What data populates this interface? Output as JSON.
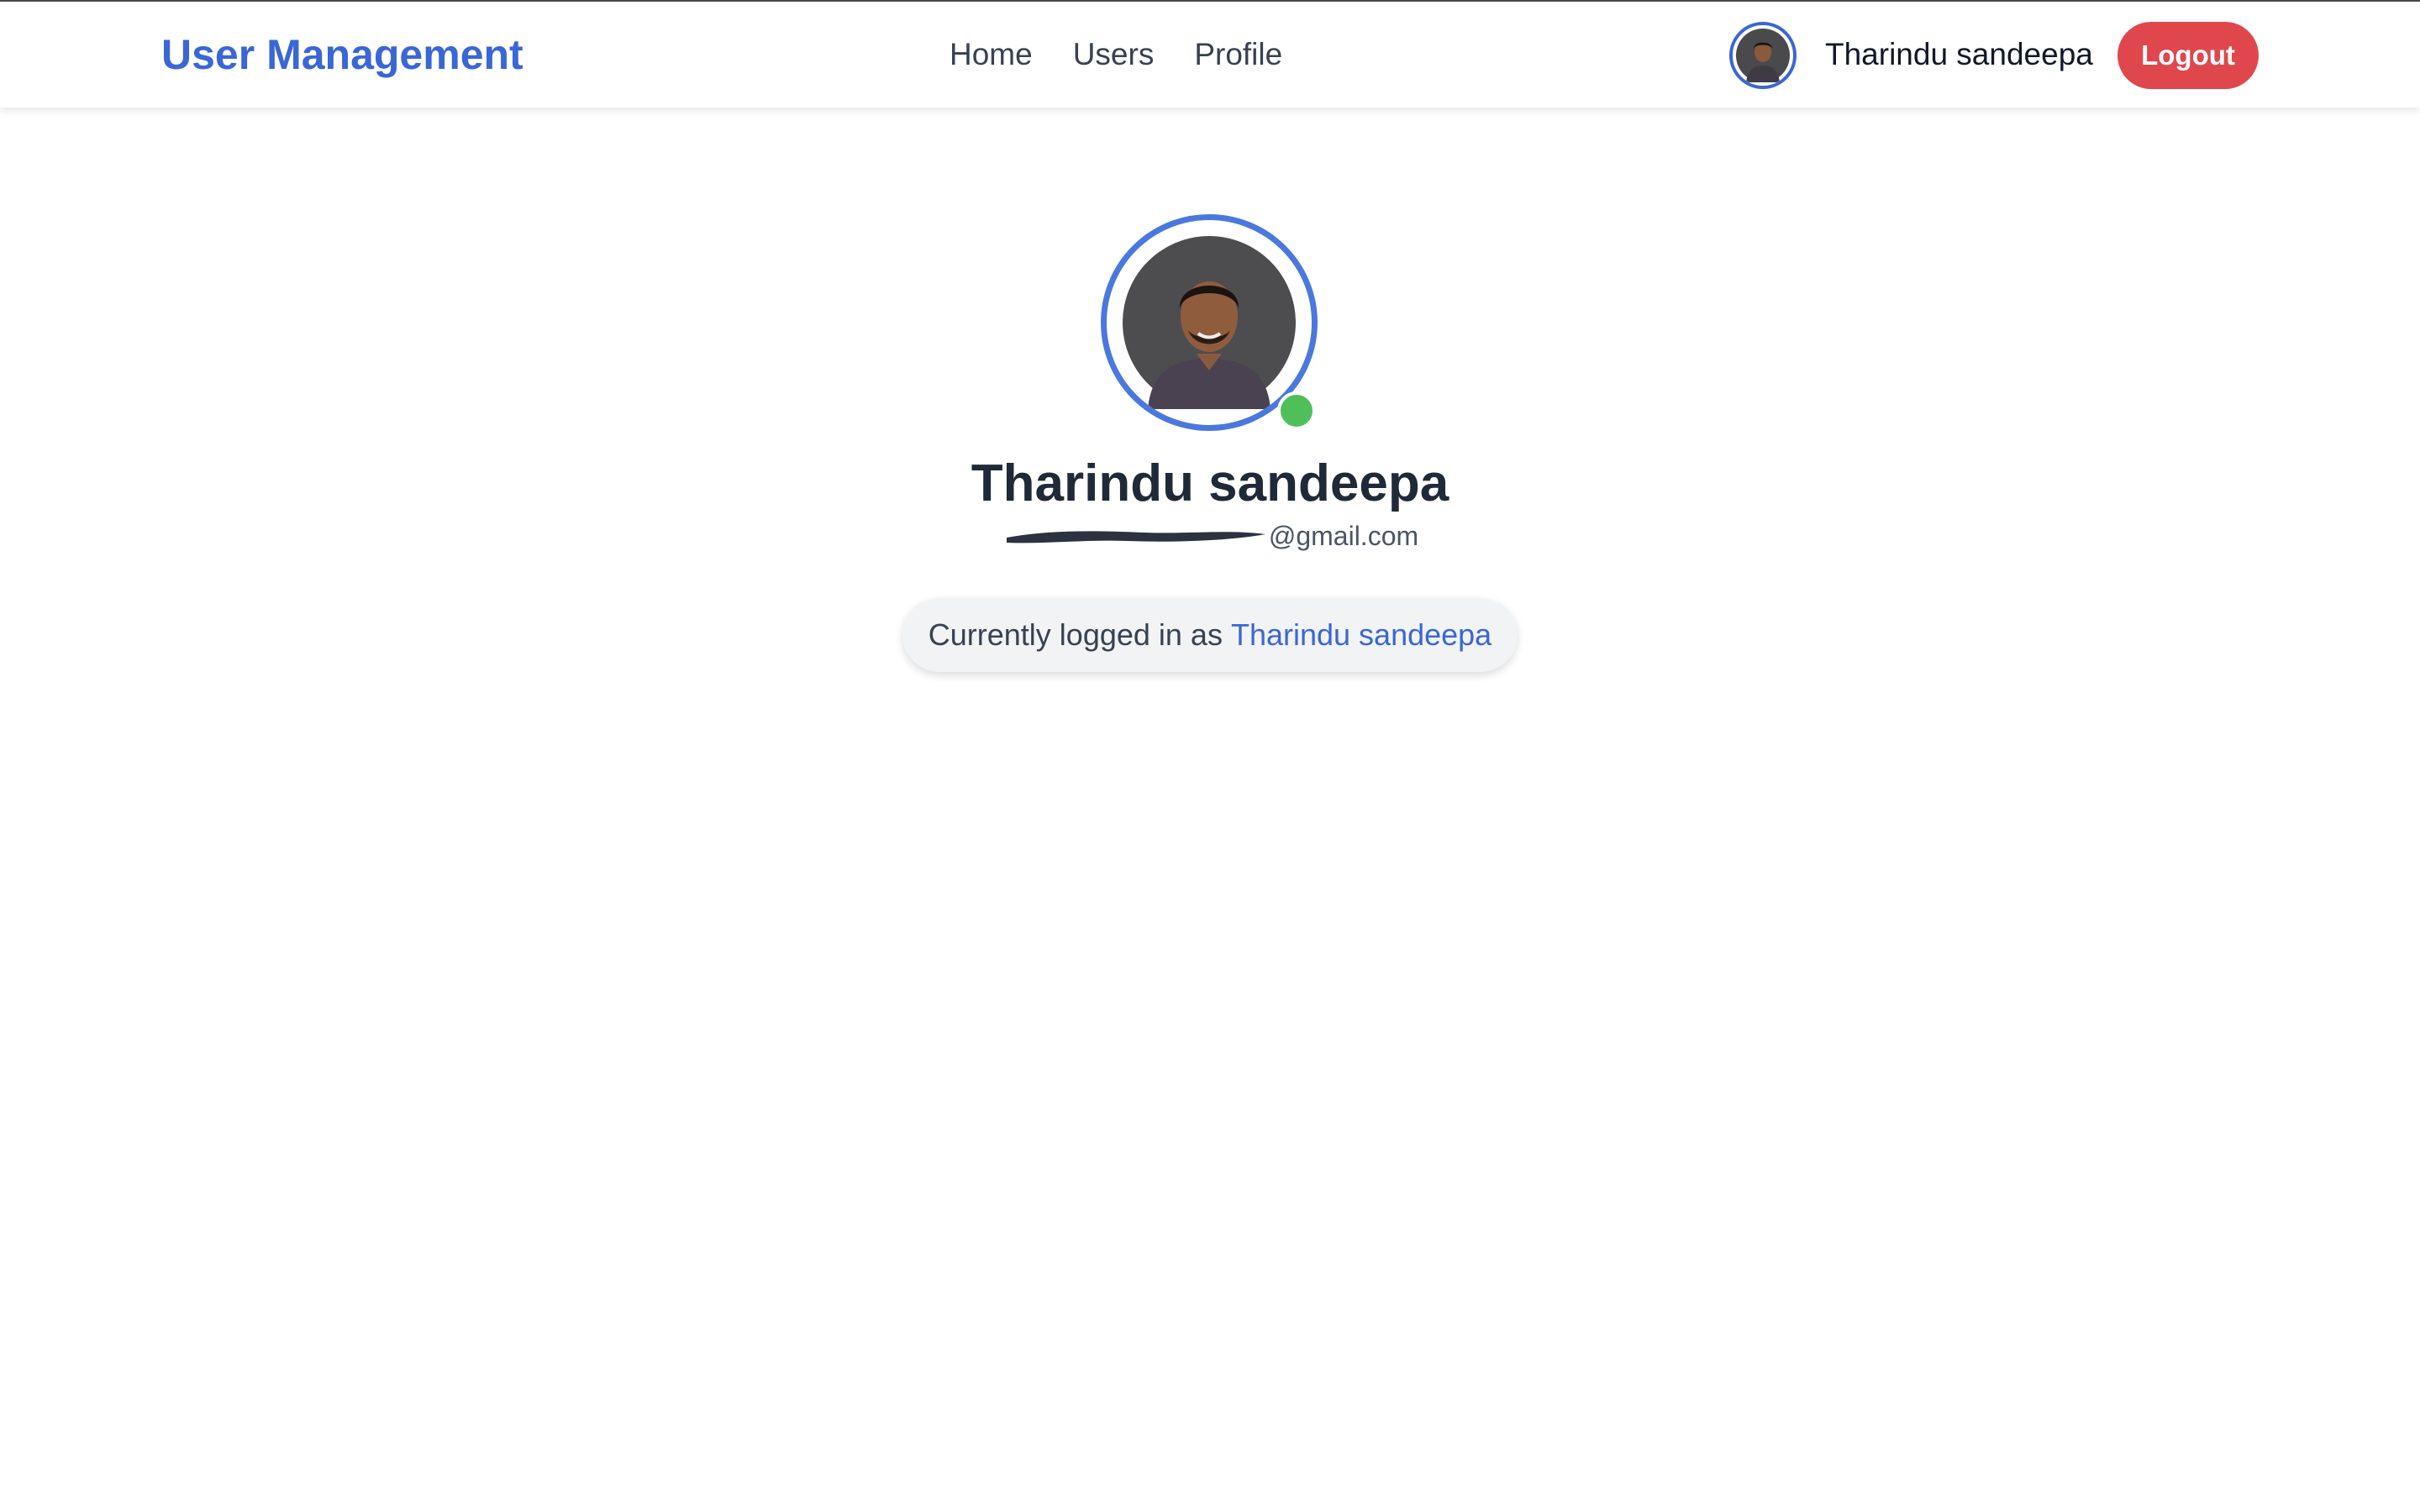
{
  "navbar": {
    "brand": "User Management",
    "links": [
      "Home",
      "Users",
      "Profile"
    ],
    "user_name": "Tharindu sandeepa",
    "logout_label": "Logout",
    "avatar_icon": "user-photo-icon"
  },
  "profile": {
    "name": "Tharindu sandeepa",
    "email_visible_suffix": "@gmail.com",
    "email_redacted": true,
    "online_status": "online",
    "avatar_icon": "user-photo-icon"
  },
  "login_status": {
    "prefix": "Currently logged in as",
    "user": "Tharindu sandeepa"
  },
  "colors": {
    "brand": "#3a66d6",
    "logout": "#e0474c",
    "online": "#4fbf5a",
    "avatar_ring": "#4a78de"
  }
}
